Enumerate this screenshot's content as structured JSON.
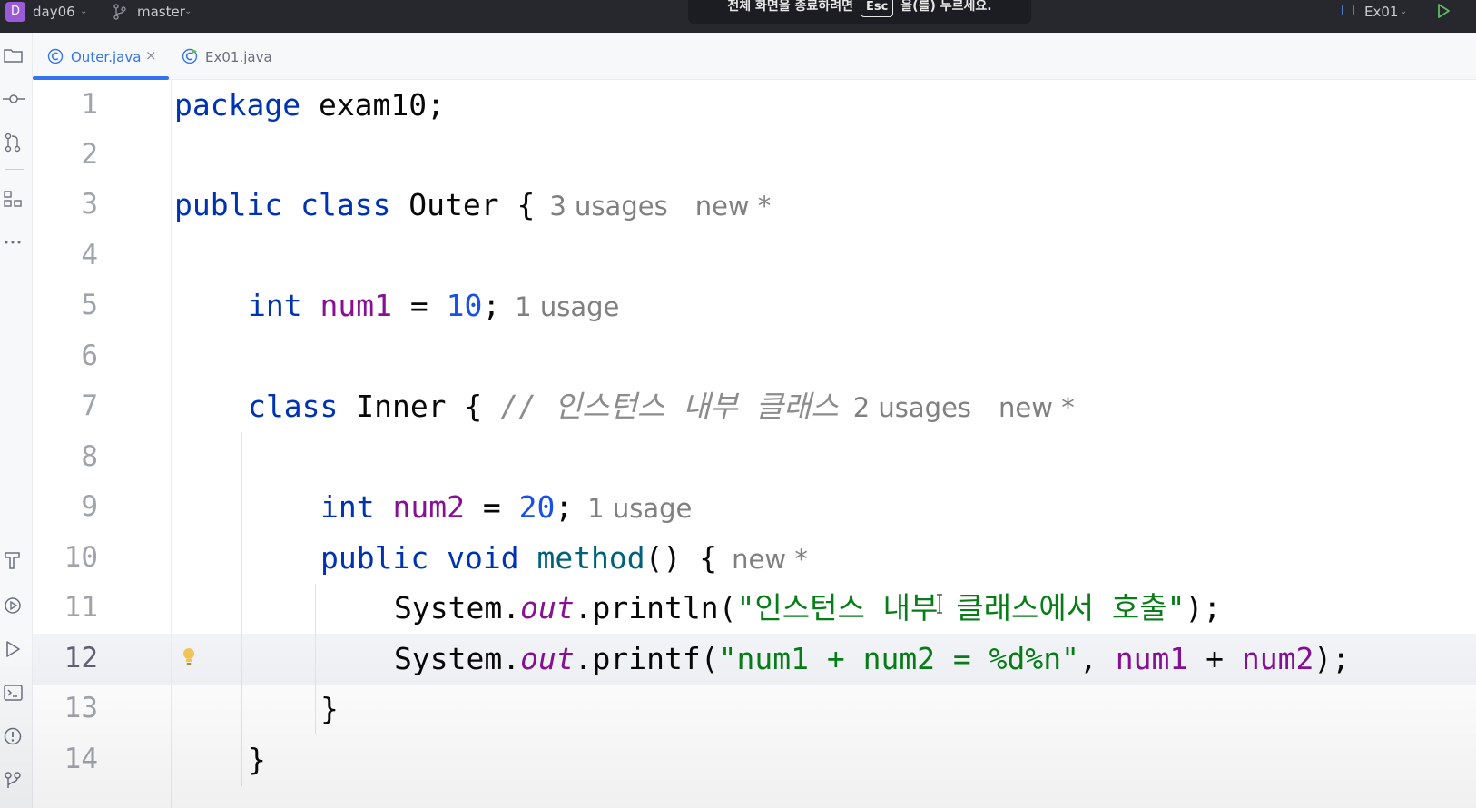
{
  "topbar": {
    "project_initial": "D",
    "project_name": "day06",
    "branch": "master",
    "banner_prefix": "전체 화면을 종료하려면",
    "banner_key": "Esc",
    "banner_suffix": "을(를) 누르세요.",
    "run_config": "Ex01"
  },
  "tabs": [
    {
      "label": "Outer.java",
      "active": true,
      "icon": "class-c-icon",
      "close": "×"
    },
    {
      "label": "Ex01.java",
      "active": false,
      "icon": "runnable-class-icon"
    }
  ],
  "editor": {
    "line_numbers": [
      "1",
      "2",
      "3",
      "4",
      "5",
      "6",
      "7",
      "8",
      "9",
      "10",
      "11",
      "12",
      "13",
      "14"
    ],
    "current_line": "12",
    "lines": {
      "l1": {
        "kw": "package",
        "rest": " exam10;"
      },
      "l3": {
        "kw1": "public",
        "kw2": "class",
        "name": " Outer {",
        "hint1": "3 usages",
        "hint2": "new *"
      },
      "l5": {
        "kw": "int",
        "field": "num1",
        "op": " = ",
        "num": "10",
        "end": ";",
        "hint": "1 usage"
      },
      "l7": {
        "kw": "class",
        "name": " Inner { ",
        "comment": "// 인스턴스 내부 클래스",
        "hint1": "2 usages",
        "hint2": "new *"
      },
      "l9": {
        "kw": "int",
        "field": "num2",
        "op": " = ",
        "num": "20",
        "end": ";",
        "hint": "1 usage"
      },
      "l10": {
        "kw1": "public",
        "kw2": "void",
        "method": "method",
        "rest": "() {",
        "hint": "new *"
      },
      "l11": {
        "obj": "System.",
        "static": "out",
        "call": ".println(",
        "str": "\"인스턴스 내부 클래스에서 호출\"",
        "end": ");"
      },
      "l12": {
        "obj": "System.",
        "static": "out",
        "call": ".printf(",
        "str": "\"num1 + num2 = %d%n\"",
        "sep": ", ",
        "f1": "num1",
        "plus": " + ",
        "f2": "num2",
        "end": ");"
      },
      "l13": {
        "brace": "}"
      },
      "l14": {
        "brace": "}"
      }
    }
  },
  "left_toolbar_icons": [
    "folder-icon",
    "commit-icon",
    "pull-requests-icon",
    "structure-icon",
    "more-icon",
    "build-icon",
    "services-icon",
    "run-icon",
    "terminal-icon",
    "problems-icon",
    "git-icon"
  ],
  "colors": {
    "keyword": "#0033b3",
    "field": "#871094",
    "number": "#1750eb",
    "string": "#067d17",
    "method": "#00627a",
    "comment": "#8c8c8c",
    "hint": "#808080",
    "accent": "#3574f0"
  }
}
